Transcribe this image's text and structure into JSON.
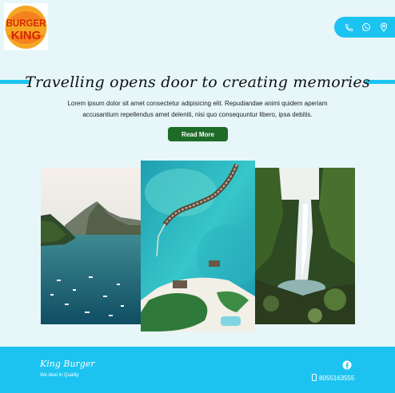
{
  "header": {
    "logo_text": [
      "BURGER",
      "KING"
    ],
    "contact_icons": [
      "phone-icon",
      "whatsapp-icon",
      "location-pin-icon"
    ]
  },
  "hero": {
    "title": "Travelling opens door to creating memories",
    "description": "Lorem ipsum dolor sit amet consectetur adipisicing elit. Repudiandae animi quidem aperiam accusantium repellendus amet deleniti, nisi quo consequuntur libero, ipsa debitis.",
    "cta_label": "Read More"
  },
  "gallery": {
    "images": [
      "Tropical bay with boats and mountains",
      "Aerial view of overwater villas",
      "Waterfall in jungle"
    ]
  },
  "footer": {
    "brand": "King Burger",
    "tagline": "We deal in Quality",
    "phone": "8055163555"
  },
  "colors": {
    "background": "#e6f6f9",
    "accent": "#1cc3f1",
    "button": "#1e6b27"
  }
}
